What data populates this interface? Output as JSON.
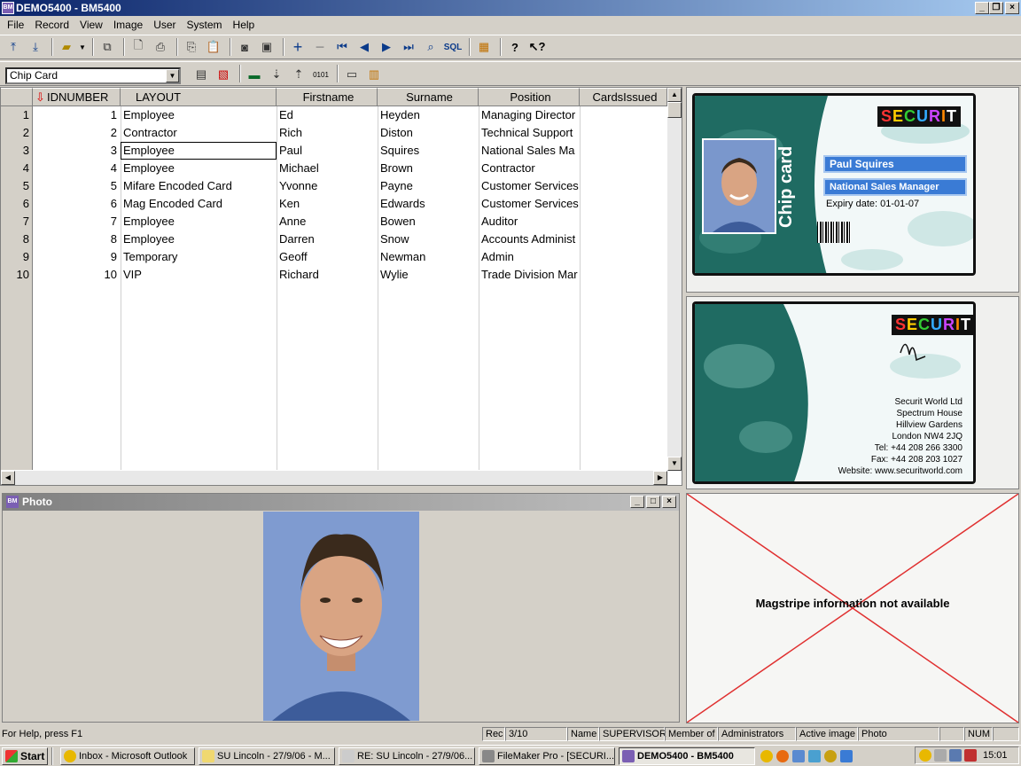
{
  "window": {
    "title": "DEMO5400 - BM5400"
  },
  "menu": [
    "File",
    "Record",
    "View",
    "Image",
    "User",
    "System",
    "Help"
  ],
  "toolbar": {
    "sql_label": "SQL"
  },
  "layout_select": {
    "value": "Chip Card"
  },
  "grid": {
    "columns": [
      "IDNUMBER",
      "LAYOUT",
      "Firstname",
      "Surname",
      "Position",
      "CardsIssued"
    ],
    "selected_row": 3,
    "rows": [
      {
        "n": "1",
        "id": "1",
        "layout": "Employee",
        "first": "Ed",
        "last": "Heyden",
        "pos": "Managing Director"
      },
      {
        "n": "2",
        "id": "2",
        "layout": "Contractor",
        "first": "Rich",
        "last": "Diston",
        "pos": "Technical Support"
      },
      {
        "n": "3",
        "id": "3",
        "layout": "Employee",
        "first": "Paul",
        "last": "Squires",
        "pos": "National Sales Ma"
      },
      {
        "n": "4",
        "id": "4",
        "layout": "Employee",
        "first": "Michael",
        "last": "Brown",
        "pos": "Contractor"
      },
      {
        "n": "5",
        "id": "5",
        "layout": "Mifare Encoded Card",
        "first": "Yvonne",
        "last": "Payne",
        "pos": "Customer Services"
      },
      {
        "n": "6",
        "id": "6",
        "layout": "Mag Encoded Card",
        "first": "Ken",
        "last": "Edwards",
        "pos": "Customer Services"
      },
      {
        "n": "7",
        "id": "7",
        "layout": "Employee",
        "first": "Anne",
        "last": "Bowen",
        "pos": "Auditor"
      },
      {
        "n": "8",
        "id": "8",
        "layout": "Employee",
        "first": "Darren",
        "last": "Snow",
        "pos": "Accounts Administ"
      },
      {
        "n": "9",
        "id": "9",
        "layout": "Temporary",
        "first": "Geoff",
        "last": "Newman",
        "pos": "Admin"
      },
      {
        "n": "10",
        "id": "10",
        "layout": "VIP",
        "first": "Richard",
        "last": "Wylie",
        "pos": "Trade Division Mar"
      }
    ]
  },
  "card_front": {
    "brand": "SECURIT",
    "vertical_text": "Chip card",
    "name": "Paul Squires",
    "title": "National Sales Manager",
    "expiry": "Expiry date: 01-01-07"
  },
  "card_back": {
    "brand": "SECURIT",
    "address": [
      "Securit World Ltd",
      "Spectrum House",
      "Hillview Gardens",
      "London NW4 2JQ",
      "Tel: +44 208 266 3300",
      "Fax: +44 208 203 1027",
      "Website: www.securitworld.com"
    ]
  },
  "magstripe": {
    "message": "Magstripe information not available"
  },
  "photo_window": {
    "title": "Photo"
  },
  "status": {
    "help": "For Help, press F1",
    "rec_label": "Rec",
    "rec_value": "3/10",
    "name_label": "Name",
    "name_value": "SUPERVISOR",
    "member_label": "Member of",
    "member_value": "Administrators",
    "active_label": "Active image",
    "active_value": "Photo",
    "num": "NUM"
  },
  "taskbar": {
    "start": "Start",
    "tasks": [
      "Inbox - Microsoft Outlook",
      "SU Lincoln - 27/9/06 - M...",
      "RE: SU Lincoln - 27/9/06...",
      "FileMaker Pro - [SECURI...",
      "DEMO5400 - BM5400"
    ],
    "clock": "15:01"
  },
  "colors": {
    "titlebar": "#0a246a",
    "card_teal": "#1f6b62",
    "magstripe_x": "#e03030"
  }
}
